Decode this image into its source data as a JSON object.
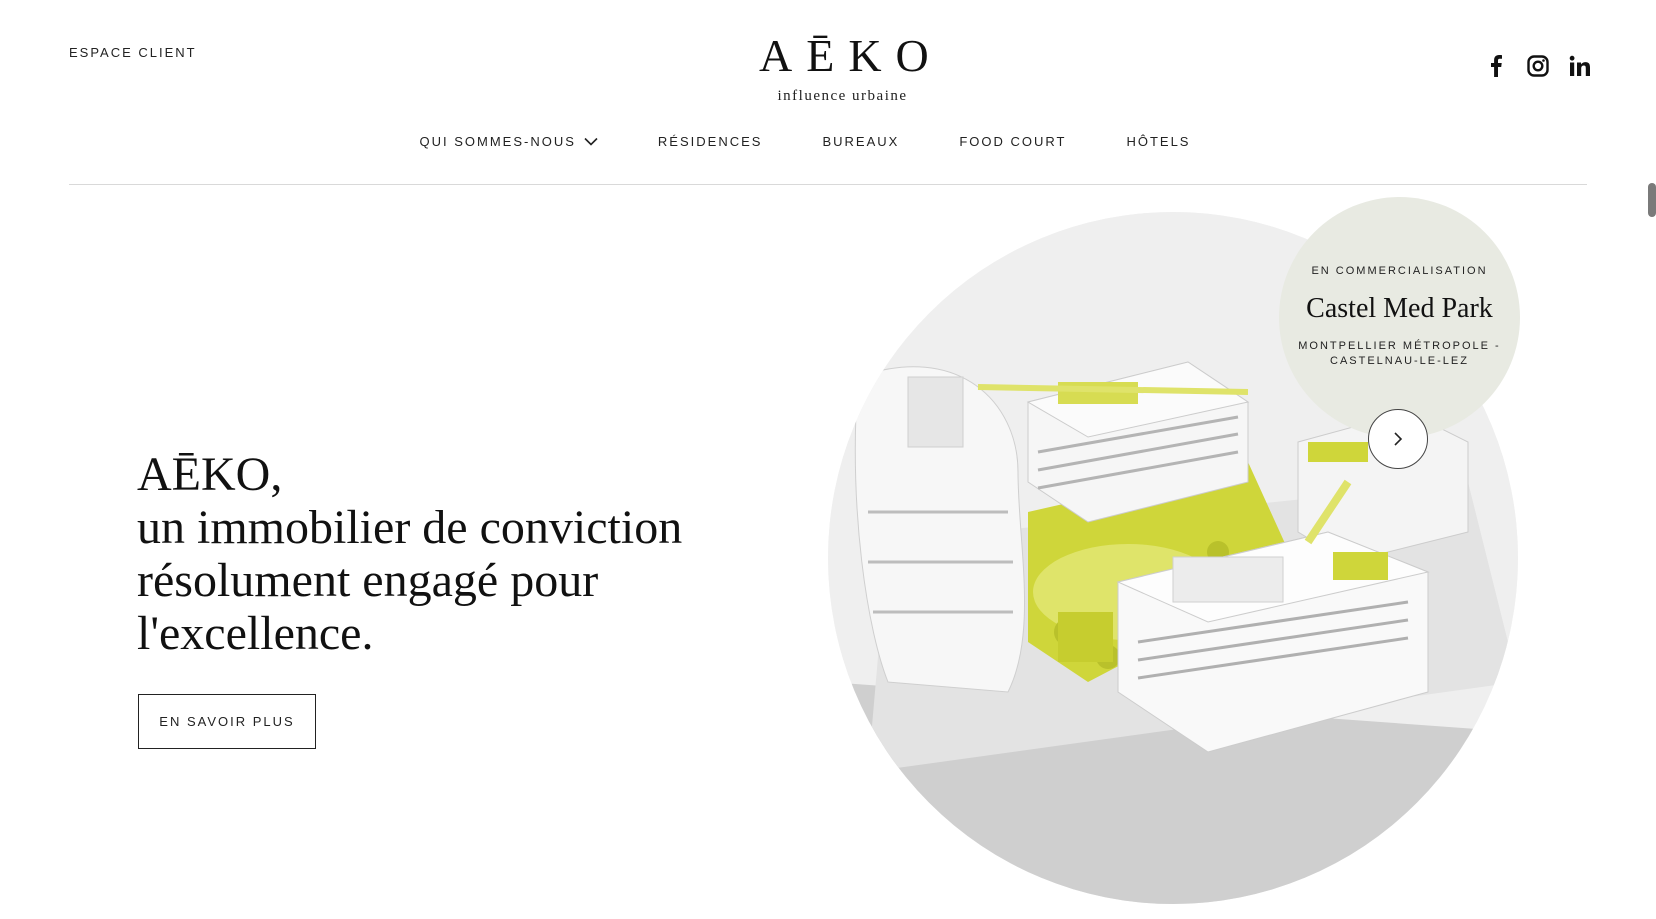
{
  "header": {
    "espace_client": "ESPACE CLIENT",
    "logo_mark": "AĒKO",
    "logo_tagline": "influence urbaine",
    "social": [
      "facebook-icon",
      "instagram-icon",
      "linkedin-icon"
    ]
  },
  "nav": {
    "items": [
      {
        "label": "QUI SOMMES-NOUS",
        "has_dropdown": true
      },
      {
        "label": "RÉSIDENCES"
      },
      {
        "label": "BUREAUX"
      },
      {
        "label": "FOOD COURT"
      },
      {
        "label": "HÔTELS"
      }
    ]
  },
  "hero": {
    "line1": "AĒKO,",
    "line2": "un immobilier de conviction",
    "line3": "résolument engagé pour",
    "line4": "l'excellence.",
    "cta": "EN SAVOIR PLUS"
  },
  "feature": {
    "kicker": "EN COMMERCIALISATION",
    "title": "Castel Med Park",
    "location_line1": "MONTPELLIER MÉTROPOLE -",
    "location_line2": "CASTELNAU-LE-LEZ"
  },
  "colors": {
    "accent_green": "#d8df3a",
    "badge_bg": "#e8eae2"
  }
}
